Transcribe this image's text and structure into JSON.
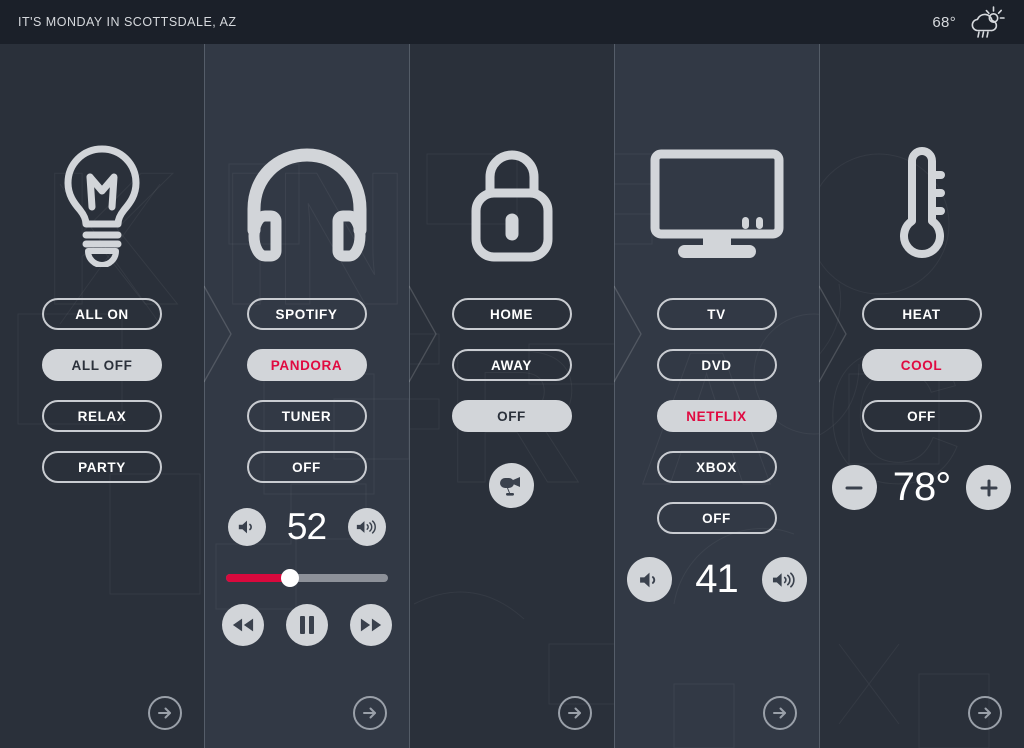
{
  "header": {
    "title": "IT'S MONDAY IN SCOTTSDALE, AZ",
    "temperature": "68°",
    "weather_icon": "partly-cloudy-rain-icon"
  },
  "theme": {
    "accent": "#e00a41",
    "slider_fill": "#d9093d",
    "panel_dark": "#2a303a",
    "panel_light": "#323945",
    "header_bg": "#1b2029",
    "pill_active_bg": "#d2d5d9",
    "icon_color": "#d2d5d9"
  },
  "panels": [
    {
      "id": "lighting",
      "icon": "lightbulb-icon",
      "watermark": "K",
      "buttons": [
        {
          "label": "ALL ON",
          "active": false,
          "accent": false
        },
        {
          "label": "ALL OFF",
          "active": true,
          "accent": false
        },
        {
          "label": "RELAX",
          "active": false,
          "accent": false
        },
        {
          "label": "PARTY",
          "active": false,
          "accent": false
        }
      ],
      "go_label": "arrow-right-icon"
    },
    {
      "id": "audio",
      "icon": "headphones-icon",
      "watermark": "IN",
      "buttons": [
        {
          "label": "SPOTIFY",
          "active": false,
          "accent": false
        },
        {
          "label": "PANDORA",
          "active": true,
          "accent": true
        },
        {
          "label": "TUNER",
          "active": false,
          "accent": false
        },
        {
          "label": "OFF",
          "active": false,
          "accent": false
        }
      ],
      "volume": {
        "value": "52",
        "down_icon": "volume-down-icon",
        "up_icon": "volume-up-icon"
      },
      "slider": {
        "percent": 40
      },
      "transport": {
        "prev_icon": "rewind-icon",
        "pause_icon": "pause-icon",
        "next_icon": "fast-forward-icon"
      },
      "go_label": "arrow-right-icon"
    },
    {
      "id": "security",
      "icon": "padlock-icon",
      "watermark": "R",
      "buttons": [
        {
          "label": "HOME",
          "active": false,
          "accent": false
        },
        {
          "label": "AWAY",
          "active": false,
          "accent": false
        },
        {
          "label": "OFF",
          "active": true,
          "accent": false
        }
      ],
      "camera_button": {
        "icon": "cctv-camera-icon"
      },
      "go_label": "arrow-right-icon"
    },
    {
      "id": "media",
      "icon": "television-icon",
      "watermark": "A",
      "buttons": [
        {
          "label": "TV",
          "active": false,
          "accent": false
        },
        {
          "label": "DVD",
          "active": false,
          "accent": false
        },
        {
          "label": "NETFLIX",
          "active": true,
          "accent": true
        },
        {
          "label": "XBOX",
          "active": false,
          "accent": false
        },
        {
          "label": "OFF",
          "active": false,
          "accent": false
        }
      ],
      "volume": {
        "value": "41",
        "down_icon": "volume-down-icon",
        "up_icon": "volume-up-icon"
      },
      "go_label": "arrow-right-icon"
    },
    {
      "id": "climate",
      "icon": "thermometer-icon",
      "watermark": "C",
      "buttons": [
        {
          "label": "HEAT",
          "active": false,
          "accent": false
        },
        {
          "label": "COOL",
          "active": true,
          "accent": true
        },
        {
          "label": "OFF",
          "active": false,
          "accent": false
        }
      ],
      "thermostat": {
        "value": "78°",
        "decrease_icon": "minus-icon",
        "increase_icon": "plus-icon"
      },
      "go_label": "arrow-right-icon"
    }
  ]
}
